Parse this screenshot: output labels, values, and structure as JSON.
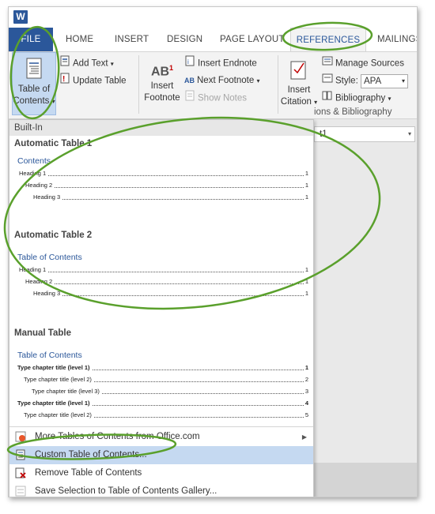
{
  "app": {
    "logo_letter": "W"
  },
  "tabs": [
    {
      "id": "file",
      "label": "FILE"
    },
    {
      "id": "home",
      "label": "HOME"
    },
    {
      "id": "insert",
      "label": "INSERT"
    },
    {
      "id": "design",
      "label": "DESIGN"
    },
    {
      "id": "layout",
      "label": "PAGE LAYOUT"
    },
    {
      "id": "references",
      "label": "REFERENCES"
    },
    {
      "id": "mailings",
      "label": "MAILINGS"
    }
  ],
  "ribbon": {
    "toc": {
      "line1": "Table of",
      "line2": "Contents"
    },
    "add_text": "Add Text",
    "update_table": "Update Table",
    "insert_footnote": {
      "line1": "Insert",
      "line2": "Footnote"
    },
    "footnote_icon_text": "AB",
    "footnote_sup": "1",
    "insert_endnote": "Insert Endnote",
    "next_footnote": "Next Footnote",
    "show_notes": "Show Notes",
    "insert_citation": {
      "line1": "Insert",
      "line2": "Citation"
    },
    "manage_sources": "Manage Sources",
    "style_label": "Style:",
    "style_value": "APA",
    "bibliography": "Bibliography",
    "citations_group_label": "ions & Bibliography"
  },
  "document": {
    "style_box_value": "t1"
  },
  "gallery": {
    "header": "Built-In",
    "sections": [
      {
        "title": "Automatic Table 1",
        "heading": "Contents",
        "lines": [
          {
            "text": "Heading 1",
            "page": "1"
          },
          {
            "text": "Heading 2",
            "page": "1"
          },
          {
            "text": "Heading 3",
            "page": "1"
          }
        ]
      },
      {
        "title": "Automatic Table 2",
        "heading": "Table of Contents",
        "lines": [
          {
            "text": "Heading 1",
            "page": "1"
          },
          {
            "text": "Heading 2",
            "page": "1"
          },
          {
            "text": "Heading 3",
            "page": "1"
          }
        ]
      },
      {
        "title": "Manual Table",
        "heading": "Table of Contents",
        "lines": [
          {
            "text": "Type chapter title (level 1)",
            "page": "1"
          },
          {
            "text": "Type chapter title (level 2)",
            "page": "2"
          },
          {
            "text": "Type chapter title (level 3)",
            "page": "3"
          },
          {
            "text": "Type chapter title (level 1)",
            "page": "4"
          },
          {
            "text": "Type chapter title (level 2)",
            "page": "5"
          }
        ]
      }
    ],
    "menu": {
      "more": "More Tables of Contents from Office.com",
      "custom": "Custom Table of Contents...",
      "remove": "Remove Table of Contents",
      "save": "Save Selection to Table of Contents Gallery..."
    }
  },
  "colors": {
    "accent": "#2b579a",
    "annotation": "#5aa02c",
    "highlight": "#c5d9f1"
  }
}
